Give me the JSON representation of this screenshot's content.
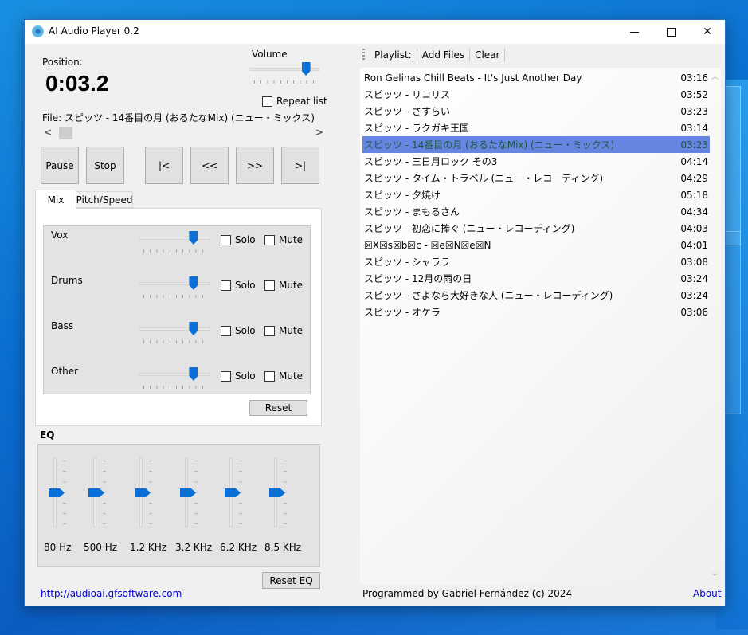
{
  "window": {
    "title": "AI Audio Player 0.2",
    "controls": {
      "minimize": "minimize",
      "maximize": "maximize",
      "close": "close"
    }
  },
  "player": {
    "position_label": "Position:",
    "position_value": "0:03.2",
    "volume_label": "Volume",
    "volume_fraction": 0.85,
    "repeat_label": "Repeat list",
    "repeat_checked": false,
    "file_text": "File: スピッツ - 14番目の月 (おるたなMix) (ニュー・ミックス)",
    "seek_fraction": 0.01,
    "seek_left": "<",
    "seek_right": ">"
  },
  "transport": {
    "pause": "Pause",
    "stop": "Stop",
    "first": "|<",
    "rewind": "<<",
    "forward": ">>",
    "last": ">|"
  },
  "tabs": [
    {
      "label": "Mix",
      "active": true
    },
    {
      "label": "Pitch/Speed",
      "active": false
    }
  ],
  "mix": {
    "channels": [
      {
        "name": "Vox",
        "level": 0.8,
        "solo_label": "Solo",
        "mute_label": "Mute",
        "solo": false,
        "mute": false
      },
      {
        "name": "Drums",
        "level": 0.8,
        "solo_label": "Solo",
        "mute_label": "Mute",
        "solo": false,
        "mute": false
      },
      {
        "name": "Bass",
        "level": 0.8,
        "solo_label": "Solo",
        "mute_label": "Mute",
        "solo": false,
        "mute": false
      },
      {
        "name": "Other",
        "level": 0.8,
        "solo_label": "Solo",
        "mute_label": "Mute",
        "solo": false,
        "mute": false
      }
    ],
    "reset_label": "Reset"
  },
  "eq": {
    "title": "EQ",
    "bands": [
      {
        "label": "80 Hz",
        "level": 0.5
      },
      {
        "label": "500 Hz",
        "level": 0.5
      },
      {
        "label": "1.2 KHz",
        "level": 0.5
      },
      {
        "label": "3.2 KHz",
        "level": 0.5
      },
      {
        "label": "6.2 KHz",
        "level": 0.5
      },
      {
        "label": "8.5 KHz",
        "level": 0.5
      }
    ],
    "reset_label": "Reset EQ"
  },
  "footer": {
    "website_link": "http://audioai.gfsoftware.com",
    "credit": "Programmed by Gabriel Fernández (c) 2024",
    "about_link": "About"
  },
  "playlist": {
    "toolbar": {
      "title": "Playlist:",
      "add_files": "Add Files",
      "clear": "Clear"
    },
    "selected_index": 4,
    "items": [
      {
        "title": "Ron Gelinas Chill Beats - It's Just Another Day",
        "duration": "03:16"
      },
      {
        "title": "スピッツ - リコリス",
        "duration": "03:52"
      },
      {
        "title": "スピッツ - さすらい",
        "duration": "03:23"
      },
      {
        "title": "スピッツ - ラクガキ王国",
        "duration": "03:14"
      },
      {
        "title": "スピッツ - 14番目の月 (おるたなMix) (ニュー・ミックス)",
        "duration": "03:23"
      },
      {
        "title": "スピッツ - 三日月ロック その3",
        "duration": "04:14"
      },
      {
        "title": "スピッツ - タイム・トラベル (ニュー・レコーディング)",
        "duration": "04:29"
      },
      {
        "title": "スピッツ - 夕焼け",
        "duration": "05:18"
      },
      {
        "title": "スピッツ - まもるさん",
        "duration": "04:34"
      },
      {
        "title": "スピッツ - 初恋に捧ぐ (ニュー・レコーディング)",
        "duration": "04:03"
      },
      {
        "title": "☒X☒s☒b☒c - ☒e☒N☒e☒N",
        "duration": "04:01"
      },
      {
        "title": "スピッツ - シャララ",
        "duration": "03:08"
      },
      {
        "title": "スピッツ - 12月の雨の日",
        "duration": "03:24"
      },
      {
        "title": "スピッツ - さよなら大好きな人 (ニュー・レコーディング)",
        "duration": "03:24"
      },
      {
        "title": "スピッツ - オケラ",
        "duration": "03:06"
      }
    ]
  }
}
